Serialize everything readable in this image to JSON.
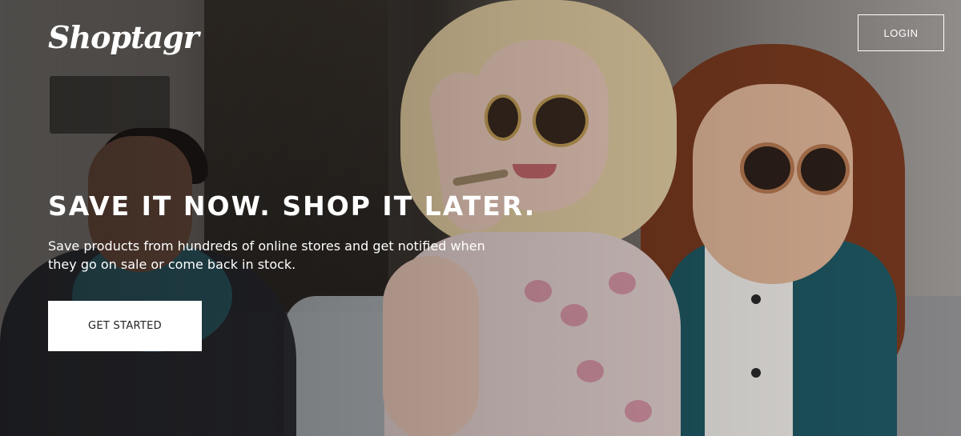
{
  "header": {
    "logo_text": "Shoptagr",
    "login_label": "LOGIN"
  },
  "hero": {
    "headline": "SAVE IT NOW. SHOP IT LATER.",
    "subtext": "Save products from hundreds of online stores and get notified when they go on sale or come back in stock.",
    "cta_label": "GET STARTED"
  }
}
